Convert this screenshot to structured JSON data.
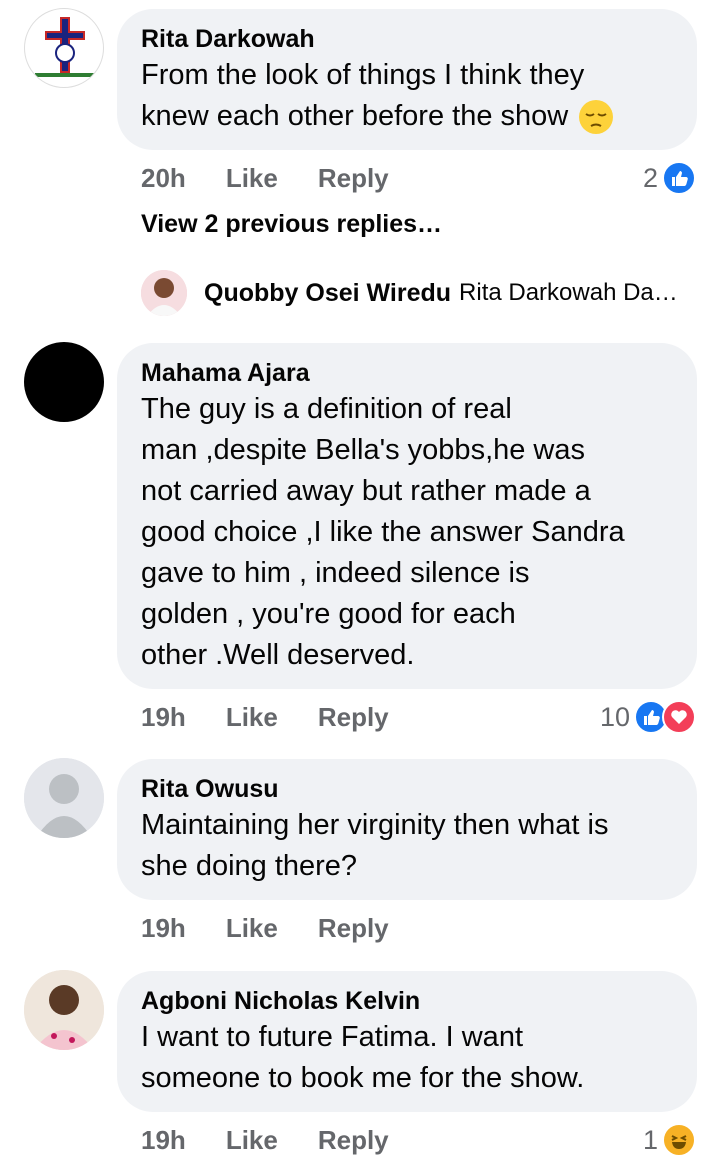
{
  "comments": [
    {
      "author": "Rita Darkowah",
      "lines": [
        "From the look of things I think they",
        "knew each other before the show"
      ],
      "emoji_name": "pensive-face-emoji",
      "time": "20h",
      "like_label": "Like",
      "reply_label": "Reply",
      "reaction_count": "2",
      "reactions": [
        "like-icon"
      ]
    },
    {
      "author": "Mahama Ajara",
      "lines": [
        "The guy is a definition of real",
        "man ,despite Bella's yobbs,he was",
        "not carried away but rather made a",
        "good choice ,I like the answer Sandra",
        "gave to him , indeed silence is",
        "golden , you're good for each",
        "other .Well deserved."
      ],
      "time": "19h",
      "like_label": "Like",
      "reply_label": "Reply",
      "reaction_count": "10",
      "reactions": [
        "like-icon",
        "love-icon"
      ]
    },
    {
      "author": "Rita Owusu",
      "lines": [
        "Maintaining her virginity then what is",
        "she doing there?"
      ],
      "time": "19h",
      "like_label": "Like",
      "reply_label": "Reply"
    },
    {
      "author": "Agboni Nicholas Kelvin",
      "lines": [
        "I want to future Fatima. I want",
        "someone to book me for the show."
      ],
      "time": "19h",
      "like_label": "Like",
      "reply_label": "Reply",
      "reaction_count": "1",
      "reactions": [
        "haha-icon"
      ]
    }
  ],
  "view_previous_replies": "View 2 previous replies…",
  "reply_preview": {
    "author": "Quobby Osei Wiredu",
    "snippet": "Rita Darkowah Da…"
  },
  "colors": {
    "bubble": "#f0f2f5",
    "meta_text": "#65676b",
    "like_blue": "#1877f2",
    "love_red": "#f33e58"
  }
}
